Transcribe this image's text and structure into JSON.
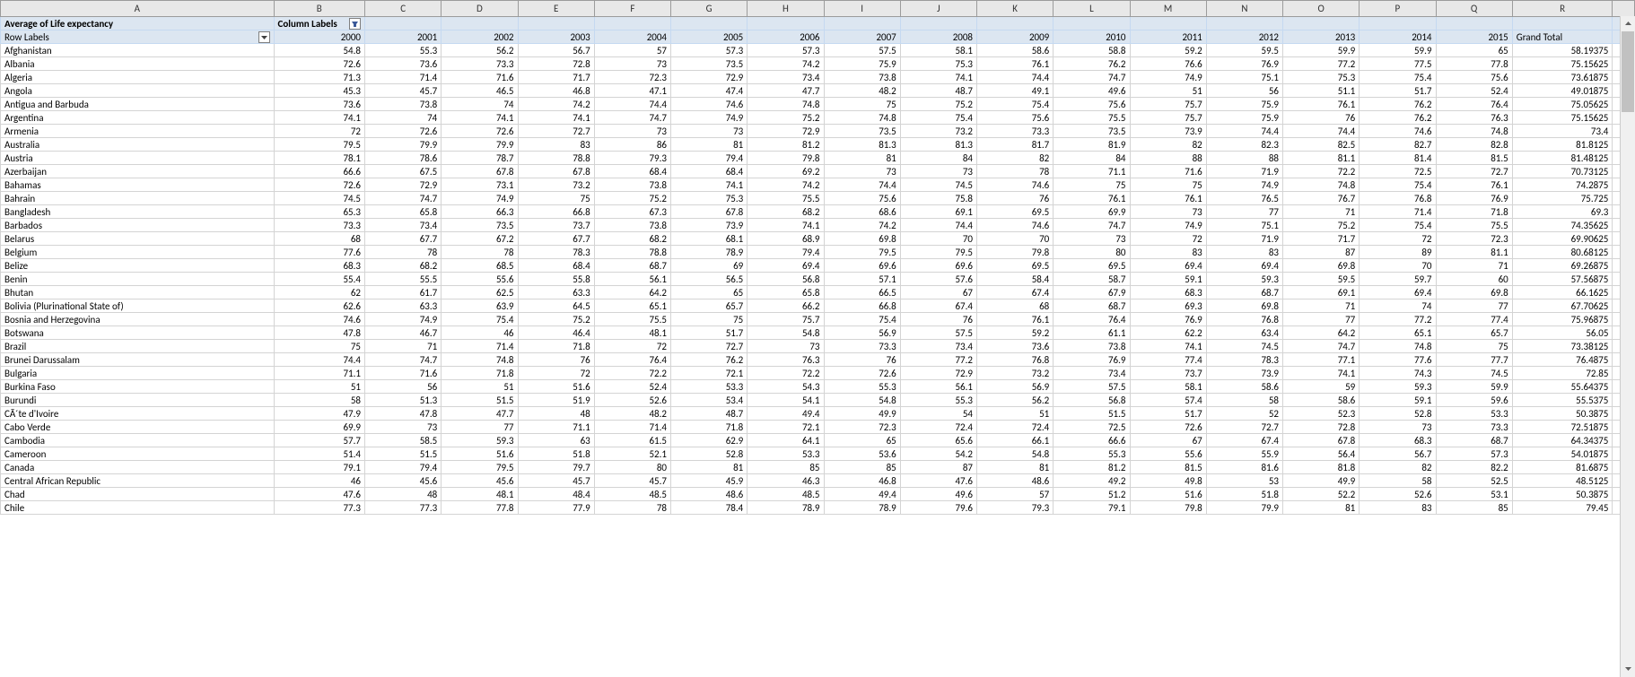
{
  "columns_letters": [
    "A",
    "B",
    "C",
    "D",
    "E",
    "F",
    "G",
    "H",
    "I",
    "J",
    "K",
    "L",
    "M",
    "N",
    "O",
    "P",
    "Q",
    "R"
  ],
  "pivot": {
    "title": "Average of Life expectancy",
    "col_labels": "Column Labels",
    "row_labels": "Row Labels",
    "years": [
      "2000",
      "2001",
      "2002",
      "2003",
      "2004",
      "2005",
      "2006",
      "2007",
      "2008",
      "2009",
      "2010",
      "2011",
      "2012",
      "2013",
      "2014",
      "2015"
    ],
    "grand_total_label": "Grand Total"
  },
  "rows": [
    {
      "label": "Afghanistan",
      "v": [
        "54.8",
        "55.3",
        "56.2",
        "56.7",
        "57",
        "57.3",
        "57.3",
        "57.5",
        "58.1",
        "58.6",
        "58.8",
        "59.2",
        "59.5",
        "59.9",
        "59.9",
        "65"
      ],
      "gt": "58.19375"
    },
    {
      "label": "Albania",
      "v": [
        "72.6",
        "73.6",
        "73.3",
        "72.8",
        "73",
        "73.5",
        "74.2",
        "75.9",
        "75.3",
        "76.1",
        "76.2",
        "76.6",
        "76.9",
        "77.2",
        "77.5",
        "77.8"
      ],
      "gt": "75.15625"
    },
    {
      "label": "Algeria",
      "v": [
        "71.3",
        "71.4",
        "71.6",
        "71.7",
        "72.3",
        "72.9",
        "73.4",
        "73.8",
        "74.1",
        "74.4",
        "74.7",
        "74.9",
        "75.1",
        "75.3",
        "75.4",
        "75.6"
      ],
      "gt": "73.61875"
    },
    {
      "label": "Angola",
      "v": [
        "45.3",
        "45.7",
        "46.5",
        "46.8",
        "47.1",
        "47.4",
        "47.7",
        "48.2",
        "48.7",
        "49.1",
        "49.6",
        "51",
        "56",
        "51.1",
        "51.7",
        "52.4"
      ],
      "gt": "49.01875"
    },
    {
      "label": "Antigua and Barbuda",
      "v": [
        "73.6",
        "73.8",
        "74",
        "74.2",
        "74.4",
        "74.6",
        "74.8",
        "75",
        "75.2",
        "75.4",
        "75.6",
        "75.7",
        "75.9",
        "76.1",
        "76.2",
        "76.4"
      ],
      "gt": "75.05625"
    },
    {
      "label": "Argentina",
      "v": [
        "74.1",
        "74",
        "74.1",
        "74.1",
        "74.7",
        "74.9",
        "75.2",
        "74.8",
        "75.4",
        "75.6",
        "75.5",
        "75.7",
        "75.9",
        "76",
        "76.2",
        "76.3"
      ],
      "gt": "75.15625"
    },
    {
      "label": "Armenia",
      "v": [
        "72",
        "72.6",
        "72.6",
        "72.7",
        "73",
        "73",
        "72.9",
        "73.5",
        "73.2",
        "73.3",
        "73.5",
        "73.9",
        "74.4",
        "74.4",
        "74.6",
        "74.8"
      ],
      "gt": "73.4"
    },
    {
      "label": "Australia",
      "v": [
        "79.5",
        "79.9",
        "79.9",
        "83",
        "86",
        "81",
        "81.2",
        "81.3",
        "81.3",
        "81.7",
        "81.9",
        "82",
        "82.3",
        "82.5",
        "82.7",
        "82.8"
      ],
      "gt": "81.8125"
    },
    {
      "label": "Austria",
      "v": [
        "78.1",
        "78.6",
        "78.7",
        "78.8",
        "79.3",
        "79.4",
        "79.8",
        "81",
        "84",
        "82",
        "84",
        "88",
        "88",
        "81.1",
        "81.4",
        "81.5"
      ],
      "gt": "81.48125"
    },
    {
      "label": "Azerbaijan",
      "v": [
        "66.6",
        "67.5",
        "67.8",
        "67.8",
        "68.4",
        "68.4",
        "69.2",
        "73",
        "73",
        "78",
        "71.1",
        "71.6",
        "71.9",
        "72.2",
        "72.5",
        "72.7"
      ],
      "gt": "70.73125"
    },
    {
      "label": "Bahamas",
      "v": [
        "72.6",
        "72.9",
        "73.1",
        "73.2",
        "73.8",
        "74.1",
        "74.2",
        "74.4",
        "74.5",
        "74.6",
        "75",
        "75",
        "74.9",
        "74.8",
        "75.4",
        "76.1"
      ],
      "gt": "74.2875"
    },
    {
      "label": "Bahrain",
      "v": [
        "74.5",
        "74.7",
        "74.9",
        "75",
        "75.2",
        "75.3",
        "75.5",
        "75.6",
        "75.8",
        "76",
        "76.1",
        "76.1",
        "76.5",
        "76.7",
        "76.8",
        "76.9"
      ],
      "gt": "75.725"
    },
    {
      "label": "Bangladesh",
      "v": [
        "65.3",
        "65.8",
        "66.3",
        "66.8",
        "67.3",
        "67.8",
        "68.2",
        "68.6",
        "69.1",
        "69.5",
        "69.9",
        "73",
        "77",
        "71",
        "71.4",
        "71.8"
      ],
      "gt": "69.3"
    },
    {
      "label": "Barbados",
      "v": [
        "73.3",
        "73.4",
        "73.5",
        "73.7",
        "73.8",
        "73.9",
        "74.1",
        "74.2",
        "74.4",
        "74.6",
        "74.7",
        "74.9",
        "75.1",
        "75.2",
        "75.4",
        "75.5"
      ],
      "gt": "74.35625"
    },
    {
      "label": "Belarus",
      "v": [
        "68",
        "67.7",
        "67.2",
        "67.7",
        "68.2",
        "68.1",
        "68.9",
        "69.8",
        "70",
        "70",
        "73",
        "72",
        "71.9",
        "71.7",
        "72",
        "72.3"
      ],
      "gt": "69.90625"
    },
    {
      "label": "Belgium",
      "v": [
        "77.6",
        "78",
        "78",
        "78.3",
        "78.8",
        "78.9",
        "79.4",
        "79.5",
        "79.5",
        "79.8",
        "80",
        "83",
        "83",
        "87",
        "89",
        "81.1"
      ],
      "gt": "80.68125"
    },
    {
      "label": "Belize",
      "v": [
        "68.3",
        "68.2",
        "68.5",
        "68.4",
        "68.7",
        "69",
        "69.4",
        "69.6",
        "69.6",
        "69.5",
        "69.5",
        "69.4",
        "69.4",
        "69.8",
        "70",
        "71"
      ],
      "gt": "69.26875"
    },
    {
      "label": "Benin",
      "v": [
        "55.4",
        "55.5",
        "55.6",
        "55.8",
        "56.1",
        "56.5",
        "56.8",
        "57.1",
        "57.6",
        "58.4",
        "58.7",
        "59.1",
        "59.3",
        "59.5",
        "59.7",
        "60"
      ],
      "gt": "57.56875"
    },
    {
      "label": "Bhutan",
      "v": [
        "62",
        "61.7",
        "62.5",
        "63.3",
        "64.2",
        "65",
        "65.8",
        "66.5",
        "67",
        "67.4",
        "67.9",
        "68.3",
        "68.7",
        "69.1",
        "69.4",
        "69.8"
      ],
      "gt": "66.1625"
    },
    {
      "label": "Bolivia (Plurinational State of)",
      "v": [
        "62.6",
        "63.3",
        "63.9",
        "64.5",
        "65.1",
        "65.7",
        "66.2",
        "66.8",
        "67.4",
        "68",
        "68.7",
        "69.3",
        "69.8",
        "71",
        "74",
        "77"
      ],
      "gt": "67.70625"
    },
    {
      "label": "Bosnia and Herzegovina",
      "v": [
        "74.6",
        "74.9",
        "75.4",
        "75.2",
        "75.5",
        "75",
        "75.7",
        "75.4",
        "76",
        "76.1",
        "76.4",
        "76.9",
        "76.8",
        "77",
        "77.2",
        "77.4"
      ],
      "gt": "75.96875"
    },
    {
      "label": "Botswana",
      "v": [
        "47.8",
        "46.7",
        "46",
        "46.4",
        "48.1",
        "51.7",
        "54.8",
        "56.9",
        "57.5",
        "59.2",
        "61.1",
        "62.2",
        "63.4",
        "64.2",
        "65.1",
        "65.7"
      ],
      "gt": "56.05"
    },
    {
      "label": "Brazil",
      "v": [
        "75",
        "71",
        "71.4",
        "71.8",
        "72",
        "72.7",
        "73",
        "73.3",
        "73.4",
        "73.6",
        "73.8",
        "74.1",
        "74.5",
        "74.7",
        "74.8",
        "75"
      ],
      "gt": "73.38125"
    },
    {
      "label": "Brunei Darussalam",
      "v": [
        "74.4",
        "74.7",
        "74.8",
        "76",
        "76.4",
        "76.2",
        "76.3",
        "76",
        "77.2",
        "76.8",
        "76.9",
        "77.4",
        "78.3",
        "77.1",
        "77.6",
        "77.7"
      ],
      "gt": "76.4875"
    },
    {
      "label": "Bulgaria",
      "v": [
        "71.1",
        "71.6",
        "71.8",
        "72",
        "72.2",
        "72.1",
        "72.2",
        "72.6",
        "72.9",
        "73.2",
        "73.4",
        "73.7",
        "73.9",
        "74.1",
        "74.3",
        "74.5"
      ],
      "gt": "72.85"
    },
    {
      "label": "Burkina Faso",
      "v": [
        "51",
        "56",
        "51",
        "51.6",
        "52.4",
        "53.3",
        "54.3",
        "55.3",
        "56.1",
        "56.9",
        "57.5",
        "58.1",
        "58.6",
        "59",
        "59.3",
        "59.9"
      ],
      "gt": "55.64375"
    },
    {
      "label": "Burundi",
      "v": [
        "58",
        "51.3",
        "51.5",
        "51.9",
        "52.6",
        "53.4",
        "54.1",
        "54.8",
        "55.3",
        "56.2",
        "56.8",
        "57.4",
        "58",
        "58.6",
        "59.1",
        "59.6"
      ],
      "gt": "55.5375"
    },
    {
      "label": "CÃ´te d'Ivoire",
      "v": [
        "47.9",
        "47.8",
        "47.7",
        "48",
        "48.2",
        "48.7",
        "49.4",
        "49.9",
        "54",
        "51",
        "51.5",
        "51.7",
        "52",
        "52.3",
        "52.8",
        "53.3"
      ],
      "gt": "50.3875"
    },
    {
      "label": "Cabo Verde",
      "v": [
        "69.9",
        "73",
        "77",
        "71.1",
        "71.4",
        "71.8",
        "72.1",
        "72.3",
        "72.4",
        "72.4",
        "72.5",
        "72.6",
        "72.7",
        "72.8",
        "73",
        "73.3"
      ],
      "gt": "72.51875"
    },
    {
      "label": "Cambodia",
      "v": [
        "57.7",
        "58.5",
        "59.3",
        "63",
        "61.5",
        "62.9",
        "64.1",
        "65",
        "65.6",
        "66.1",
        "66.6",
        "67",
        "67.4",
        "67.8",
        "68.3",
        "68.7"
      ],
      "gt": "64.34375"
    },
    {
      "label": "Cameroon",
      "v": [
        "51.4",
        "51.5",
        "51.6",
        "51.8",
        "52.1",
        "52.8",
        "53.3",
        "53.6",
        "54.2",
        "54.8",
        "55.3",
        "55.6",
        "55.9",
        "56.4",
        "56.7",
        "57.3"
      ],
      "gt": "54.01875"
    },
    {
      "label": "Canada",
      "v": [
        "79.1",
        "79.4",
        "79.5",
        "79.7",
        "80",
        "81",
        "85",
        "85",
        "87",
        "81",
        "81.2",
        "81.5",
        "81.6",
        "81.8",
        "82",
        "82.2"
      ],
      "gt": "81.6875"
    },
    {
      "label": "Central African Republic",
      "v": [
        "46",
        "45.6",
        "45.6",
        "45.7",
        "45.7",
        "45.9",
        "46.3",
        "46.8",
        "47.6",
        "48.6",
        "49.2",
        "49.8",
        "53",
        "49.9",
        "58",
        "52.5"
      ],
      "gt": "48.5125"
    },
    {
      "label": "Chad",
      "v": [
        "47.6",
        "48",
        "48.1",
        "48.4",
        "48.5",
        "48.6",
        "48.5",
        "49.4",
        "49.6",
        "57",
        "51.2",
        "51.6",
        "51.8",
        "52.2",
        "52.6",
        "53.1"
      ],
      "gt": "50.3875"
    },
    {
      "label": "Chile",
      "v": [
        "77.3",
        "77.3",
        "77.8",
        "77.9",
        "78",
        "78.4",
        "78.9",
        "78.9",
        "79.6",
        "79.3",
        "79.1",
        "79.8",
        "79.9",
        "81",
        "83",
        "85"
      ],
      "gt": "79.45"
    }
  ]
}
